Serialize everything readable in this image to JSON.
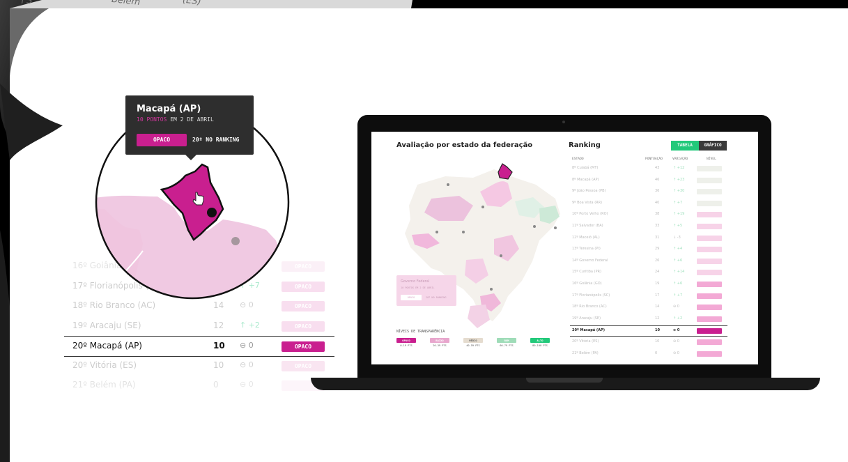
{
  "backdrop": {
    "fragments": [
      "ſ'S",
      "Belém",
      "(ES)"
    ]
  },
  "tooltip": {
    "state": "Macapá (AP)",
    "points_label": "10 PONTOS",
    "date_label": "EM 2 DE ABRIL",
    "level": "OPACO",
    "ranking": "20º NO RANKING"
  },
  "zoom_table": {
    "rows": [
      {
        "name": "16º Goiânia (GO)",
        "points": "",
        "variation": "",
        "badge": "OPACO",
        "badge_color": "#f3c6e2",
        "faded": true
      },
      {
        "name": "17º Florianópolis (SC)",
        "points": "",
        "variation": "↑ +7",
        "badge": "OPACO",
        "badge_color": "#f1b8dc",
        "faded": true
      },
      {
        "name": "18º Rio Branco (AC)",
        "points": "14",
        "variation": "⊖ 0",
        "badge": "OPACO",
        "badge_color": "#f1b8dc",
        "faded": true
      },
      {
        "name": "19º Aracaju (SE)",
        "points": "12",
        "variation": "↑ +2",
        "badge": "OPACO",
        "badge_color": "#f1b8dc",
        "faded": true
      },
      {
        "name": "20º Macapá (AP)",
        "points": "10",
        "variation": "⊖ 0",
        "badge": "OPACO",
        "badge_color": "#c91f8f",
        "faded": false
      },
      {
        "name": "20º Vitória (ES)",
        "points": "10",
        "variation": "⊖ 0",
        "badge": "OPACO",
        "badge_color": "#f3c6e2",
        "faded": true
      },
      {
        "name": "21º Belém (PA)",
        "points": "0",
        "variation": "⊖ 0",
        "badge": "",
        "badge_color": "#f7d8eb",
        "faded": true
      }
    ]
  },
  "screen": {
    "map_title": "Avaliação por estado da federação",
    "ranking_title": "Ranking",
    "tabs": [
      "TABELA",
      "GRÁFICO"
    ],
    "columns": [
      "ESTADO",
      "PONTUAÇÃO",
      "VARIAÇÃO",
      "NÍVEL"
    ],
    "rows": [
      {
        "name": "8º Cuiabá (MT)",
        "points": "43",
        "var": "↑ +12",
        "color": "#eef0ea"
      },
      {
        "name": "8º Macapá (AP)",
        "points": "46",
        "var": "↑ +23",
        "color": "#eef0ea"
      },
      {
        "name": "9º João Pessoa (PB)",
        "points": "36",
        "var": "↑ +30",
        "color": "#eef0ea"
      },
      {
        "name": "9º Boa Vista (RR)",
        "points": "40",
        "var": "↑ +7",
        "color": "#eef0ea"
      },
      {
        "name": "10º Porto Velho (RO)",
        "points": "38",
        "var": "↑ +19",
        "color": "#f7d3e8"
      },
      {
        "name": "11º Salvador (BA)",
        "points": "33",
        "var": "↑ +5",
        "color": "#f7d3e8"
      },
      {
        "name": "12º Maceió (AL)",
        "points": "31",
        "var": "↓ -3",
        "color": "#f7d3e8"
      },
      {
        "name": "13º Teresina (PI)",
        "points": "29",
        "var": "↑ +4",
        "color": "#f7d3e8"
      },
      {
        "name": "14º Governo Federal",
        "points": "26",
        "var": "↑ +6",
        "color": "#f7d3e8"
      },
      {
        "name": "15º Curitiba (PR)",
        "points": "24",
        "var": "↑ +14",
        "color": "#f7d3e8"
      },
      {
        "name": "16º Goiânia (GO)",
        "points": "19",
        "var": "↑ +6",
        "color": "#f3a9d5"
      },
      {
        "name": "17º Florianópolis (SC)",
        "points": "17",
        "var": "↑ +7",
        "color": "#f3a9d5"
      },
      {
        "name": "18º Rio Branco (AC)",
        "points": "14",
        "var": "⊖ 0",
        "color": "#f3a9d5"
      },
      {
        "name": "19º Aracaju (SE)",
        "points": "12",
        "var": "↑ +2",
        "color": "#f3a9d5"
      },
      {
        "name": "20º Macapá (AP)",
        "points": "10",
        "var": "⊖ 0",
        "color": "#c91f8f",
        "active": true
      },
      {
        "name": "20º Vitória (ES)",
        "points": "10",
        "var": "⊖ 0",
        "color": "#f3a9d5"
      },
      {
        "name": "21º Belém (PA)",
        "points": "0",
        "var": "⊖ 0",
        "color": "#f3a9d5"
      }
    ],
    "legend_box": {
      "title": "Governo Federal",
      "line": "10 PONTOS EM 2 DE ABRIL",
      "badge": "OPACO",
      "rank": "20º NO RANKING"
    },
    "levels_title": "NÍVEIS DE TRANSPARÊNCIA",
    "levels": [
      {
        "name": "OPACO",
        "range": "0-19 PTS",
        "color": "#c91f8f"
      },
      {
        "name": "BAIXO",
        "range": "20-39 PTS",
        "color": "#e8a6cd"
      },
      {
        "name": "MÉDIO",
        "range": "40-59 PTS",
        "color": "#e5dccf"
      },
      {
        "name": "BOM",
        "range": "60-79 PTS",
        "color": "#9fdcb8"
      },
      {
        "name": "ALTO",
        "range": "80-100 PTS",
        "color": "#22c97a"
      }
    ]
  },
  "colors": {
    "accent": "#c91f8f",
    "accent_light": "#f3c6e2",
    "green": "#22c97a",
    "dark": "#2e2e2e"
  }
}
